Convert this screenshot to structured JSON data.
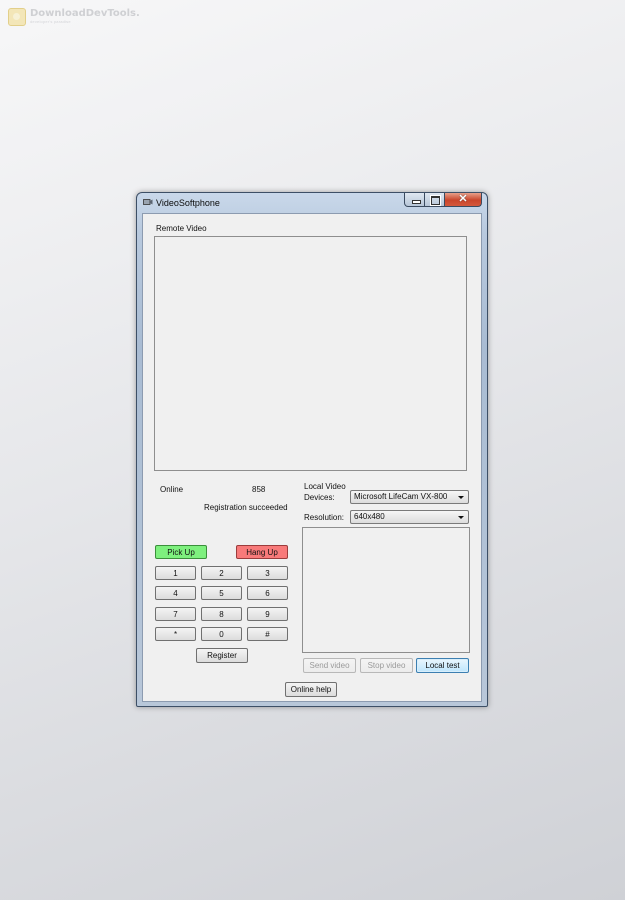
{
  "watermark": {
    "brand": "DownloadDevTools.",
    "tagline": "developer's paradise"
  },
  "window": {
    "title": "VideoSoftphone",
    "close_glyph": "✕"
  },
  "remote": {
    "label": "Remote Video"
  },
  "status": {
    "state": "Online",
    "number": "858",
    "registration": "Registration succeeded"
  },
  "local": {
    "label": "Local Video",
    "devices_label": "Devices:",
    "device_value": "Microsoft LifeCam VX-800",
    "resolution_label": "Resolution:",
    "resolution_value": "640x480"
  },
  "call": {
    "pickup": "Pick Up",
    "hangup": "Hang Up",
    "colors": {
      "pickup": "#7ef07e",
      "hangup": "#f87a7a"
    }
  },
  "keypad": {
    "keys": [
      "1",
      "2",
      "3",
      "4",
      "5",
      "6",
      "7",
      "8",
      "9",
      "*",
      "0",
      "#"
    ]
  },
  "buttons": {
    "register": "Register",
    "send_video": "Send video",
    "stop_video": "Stop video",
    "local_test": "Local test",
    "online_help": "Online help"
  }
}
